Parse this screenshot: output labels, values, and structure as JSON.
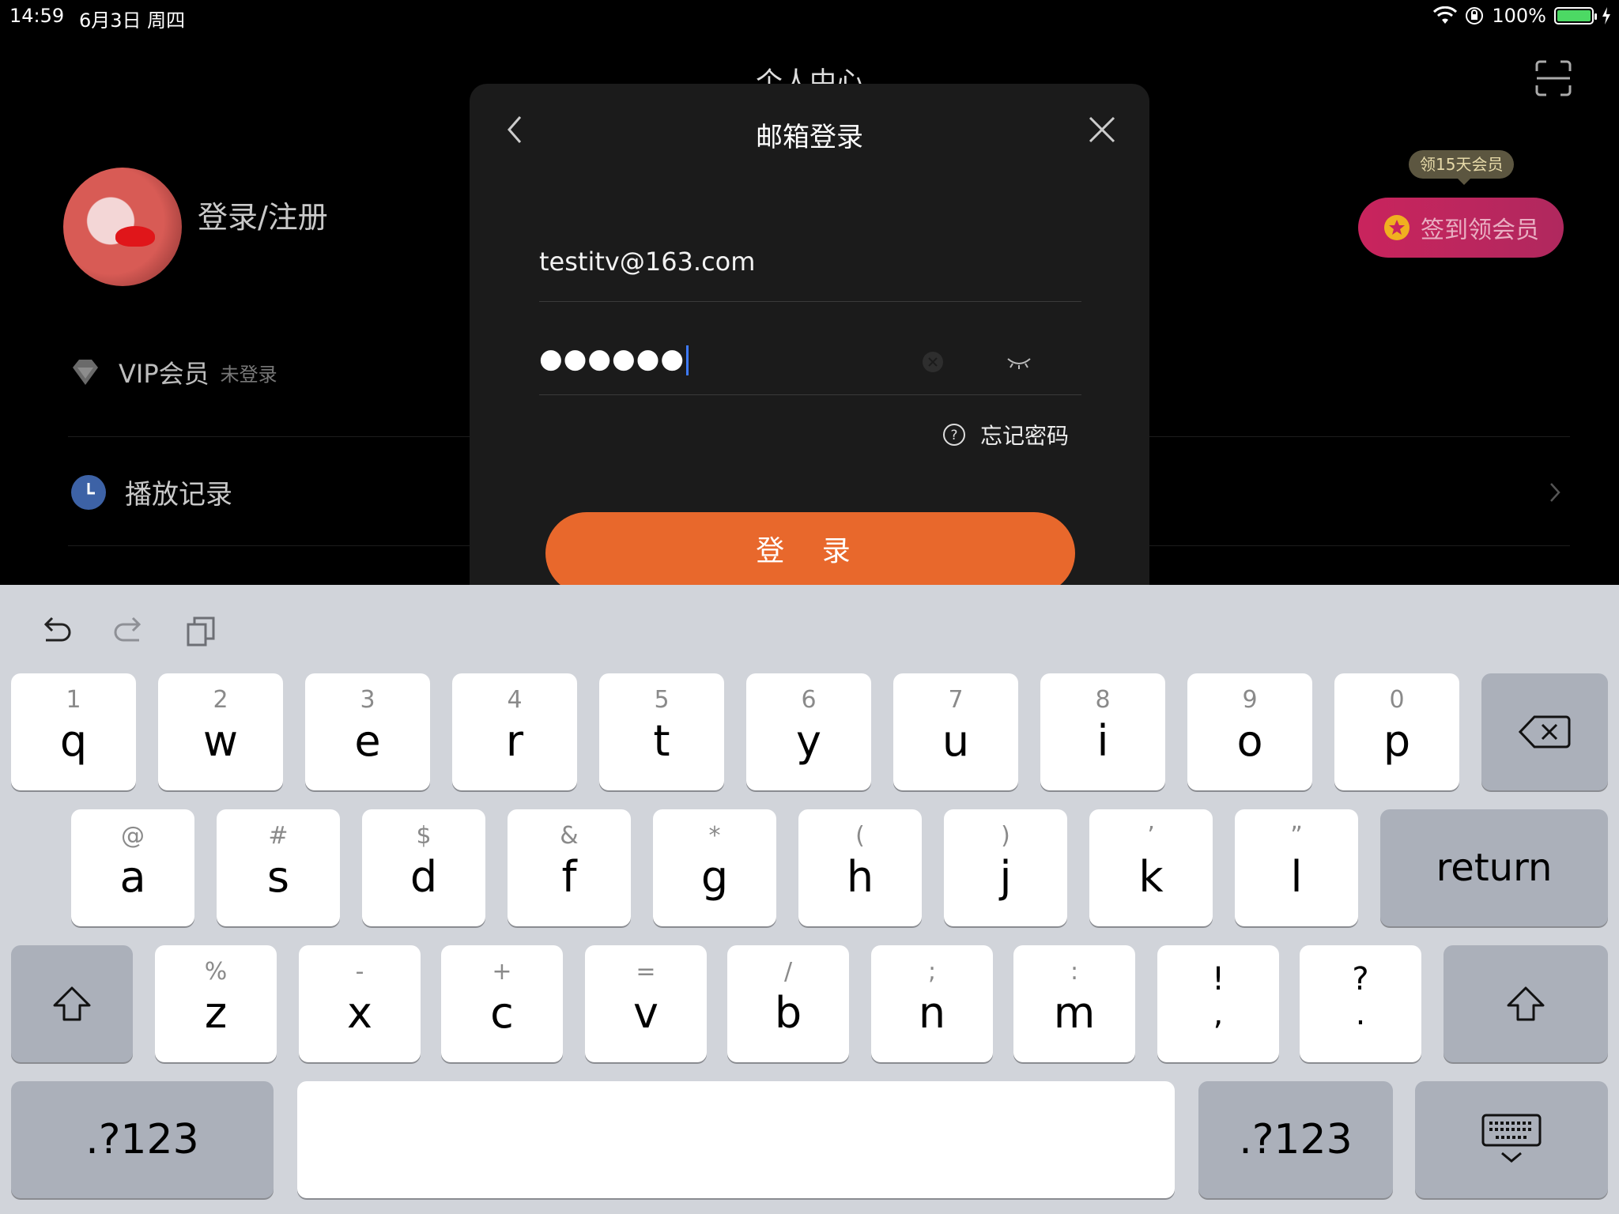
{
  "status_bar": {
    "time": "14:59",
    "date": "6月3日 周四",
    "battery": "100%"
  },
  "background": {
    "page_title": "个人中心",
    "user": {
      "login_register": "登录/注册"
    },
    "vip": {
      "label": "VIP会员",
      "status": "未登录"
    },
    "history": {
      "label": "播放记录"
    },
    "promo": {
      "badge": "领15天会员",
      "button": "签到领会员"
    }
  },
  "modal": {
    "title": "邮箱登录",
    "email_value": "testitv@163.com",
    "password_masked": "●●●●●●",
    "forgot_password": "忘记密码",
    "login_button": "登 录"
  },
  "keyboard": {
    "row1": [
      {
        "main": "q",
        "hint": "1"
      },
      {
        "main": "w",
        "hint": "2"
      },
      {
        "main": "e",
        "hint": "3"
      },
      {
        "main": "r",
        "hint": "4"
      },
      {
        "main": "t",
        "hint": "5"
      },
      {
        "main": "y",
        "hint": "6"
      },
      {
        "main": "u",
        "hint": "7"
      },
      {
        "main": "i",
        "hint": "8"
      },
      {
        "main": "o",
        "hint": "9"
      },
      {
        "main": "p",
        "hint": "0"
      }
    ],
    "row2": [
      {
        "main": "a",
        "hint": "@"
      },
      {
        "main": "s",
        "hint": "#"
      },
      {
        "main": "d",
        "hint": "$"
      },
      {
        "main": "f",
        "hint": "&"
      },
      {
        "main": "g",
        "hint": "*"
      },
      {
        "main": "h",
        "hint": "("
      },
      {
        "main": "j",
        "hint": ")"
      },
      {
        "main": "k",
        "hint": "’"
      },
      {
        "main": "l",
        "hint": "”"
      }
    ],
    "return_label": "return",
    "row3": [
      {
        "main": "z",
        "hint": "%"
      },
      {
        "main": "x",
        "hint": "-"
      },
      {
        "main": "c",
        "hint": "+"
      },
      {
        "main": "v",
        "hint": "="
      },
      {
        "main": "b",
        "hint": "/"
      },
      {
        "main": "n",
        "hint": ";"
      },
      {
        "main": "m",
        "hint": ":"
      }
    ],
    "row3_punct": [
      {
        "top": "!",
        "bottom": ","
      },
      {
        "top": "?",
        "bottom": "."
      }
    ],
    "numbers_label": ".?123"
  },
  "colors": {
    "accent": "#e8682c",
    "promo": "#c9245d",
    "caret": "#3e7bff",
    "battery": "#4cd964"
  }
}
